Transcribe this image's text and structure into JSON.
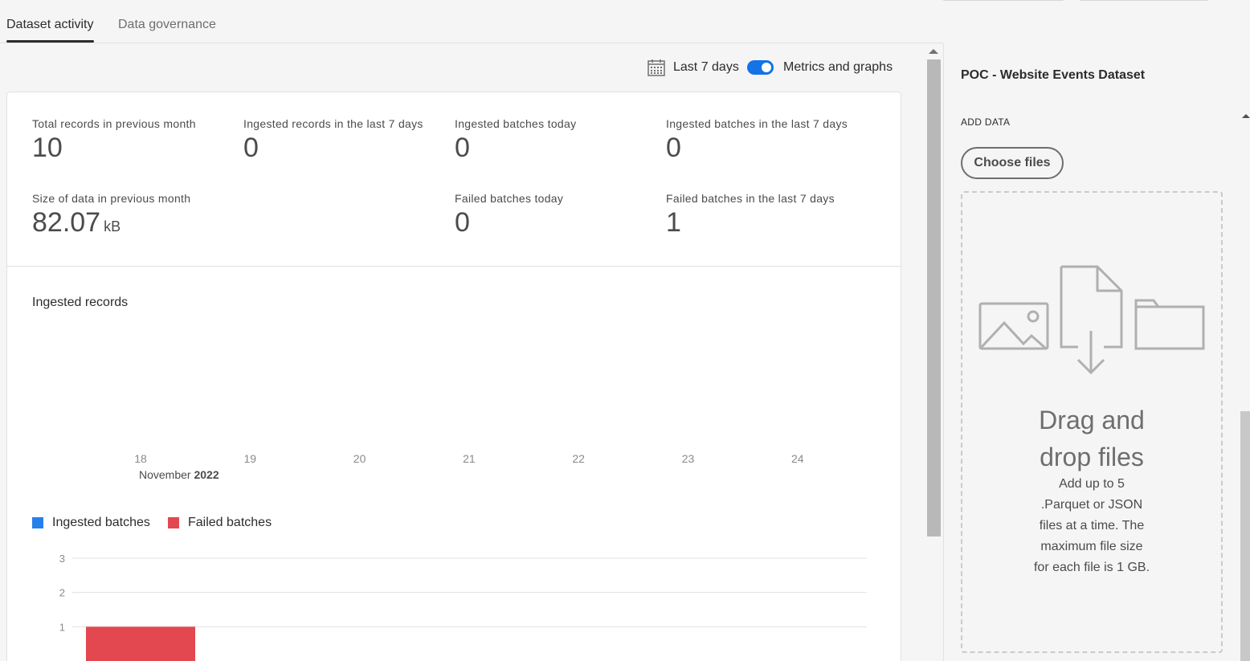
{
  "tabs": [
    {
      "label": "Dataset activity",
      "active": true
    },
    {
      "label": "Data governance",
      "active": false
    }
  ],
  "toolbar": {
    "date_range": "Last 7 days",
    "toggle_label": "Metrics and graphs",
    "toggle_on": true,
    "icon": "calendar-icon"
  },
  "metrics": [
    {
      "label": "Total records in previous month",
      "value": "10"
    },
    {
      "label": "Ingested records in the last 7 days",
      "value": "0"
    },
    {
      "label": "Ingested batches today",
      "value": "0"
    },
    {
      "label": "Ingested batches in the last 7 days",
      "value": "0"
    },
    {
      "label": "Size of data in previous month",
      "value": "82.07",
      "unit": "kB"
    },
    {
      "label": "Failed batches today",
      "value": "0"
    },
    {
      "label": "Failed batches in the last 7 days",
      "value": "1"
    }
  ],
  "records_chart": {
    "title": "Ingested records",
    "days": [
      "18",
      "19",
      "20",
      "21",
      "22",
      "23",
      "24"
    ],
    "month": "November",
    "year": "2022"
  },
  "chart_data": {
    "type": "bar",
    "categories": [
      "18",
      "19",
      "20",
      "21",
      "22",
      "23",
      "24"
    ],
    "series": [
      {
        "name": "Ingested batches",
        "color": "#2680eb",
        "values": [
          0,
          0,
          0,
          0,
          0,
          0,
          0
        ]
      },
      {
        "name": "Failed batches",
        "color": "#e34850",
        "values": [
          1,
          0,
          0,
          0,
          0,
          0,
          0
        ]
      }
    ],
    "ylim": [
      0,
      3
    ],
    "yticks": [
      "1",
      "2",
      "3"
    ],
    "grid": true,
    "legend": "top-left"
  },
  "panel": {
    "title": "POC - Website Events Dataset",
    "section_label": "ADD DATA",
    "choose_button": "Choose files",
    "drop_heading_line1": "Drag and",
    "drop_heading_line2": "drop files",
    "drop_desc_lines": [
      "Add up to 5",
      ".Parquet or JSON",
      "files at a time. The",
      "maximum file size",
      "for each file is 1 GB."
    ]
  }
}
